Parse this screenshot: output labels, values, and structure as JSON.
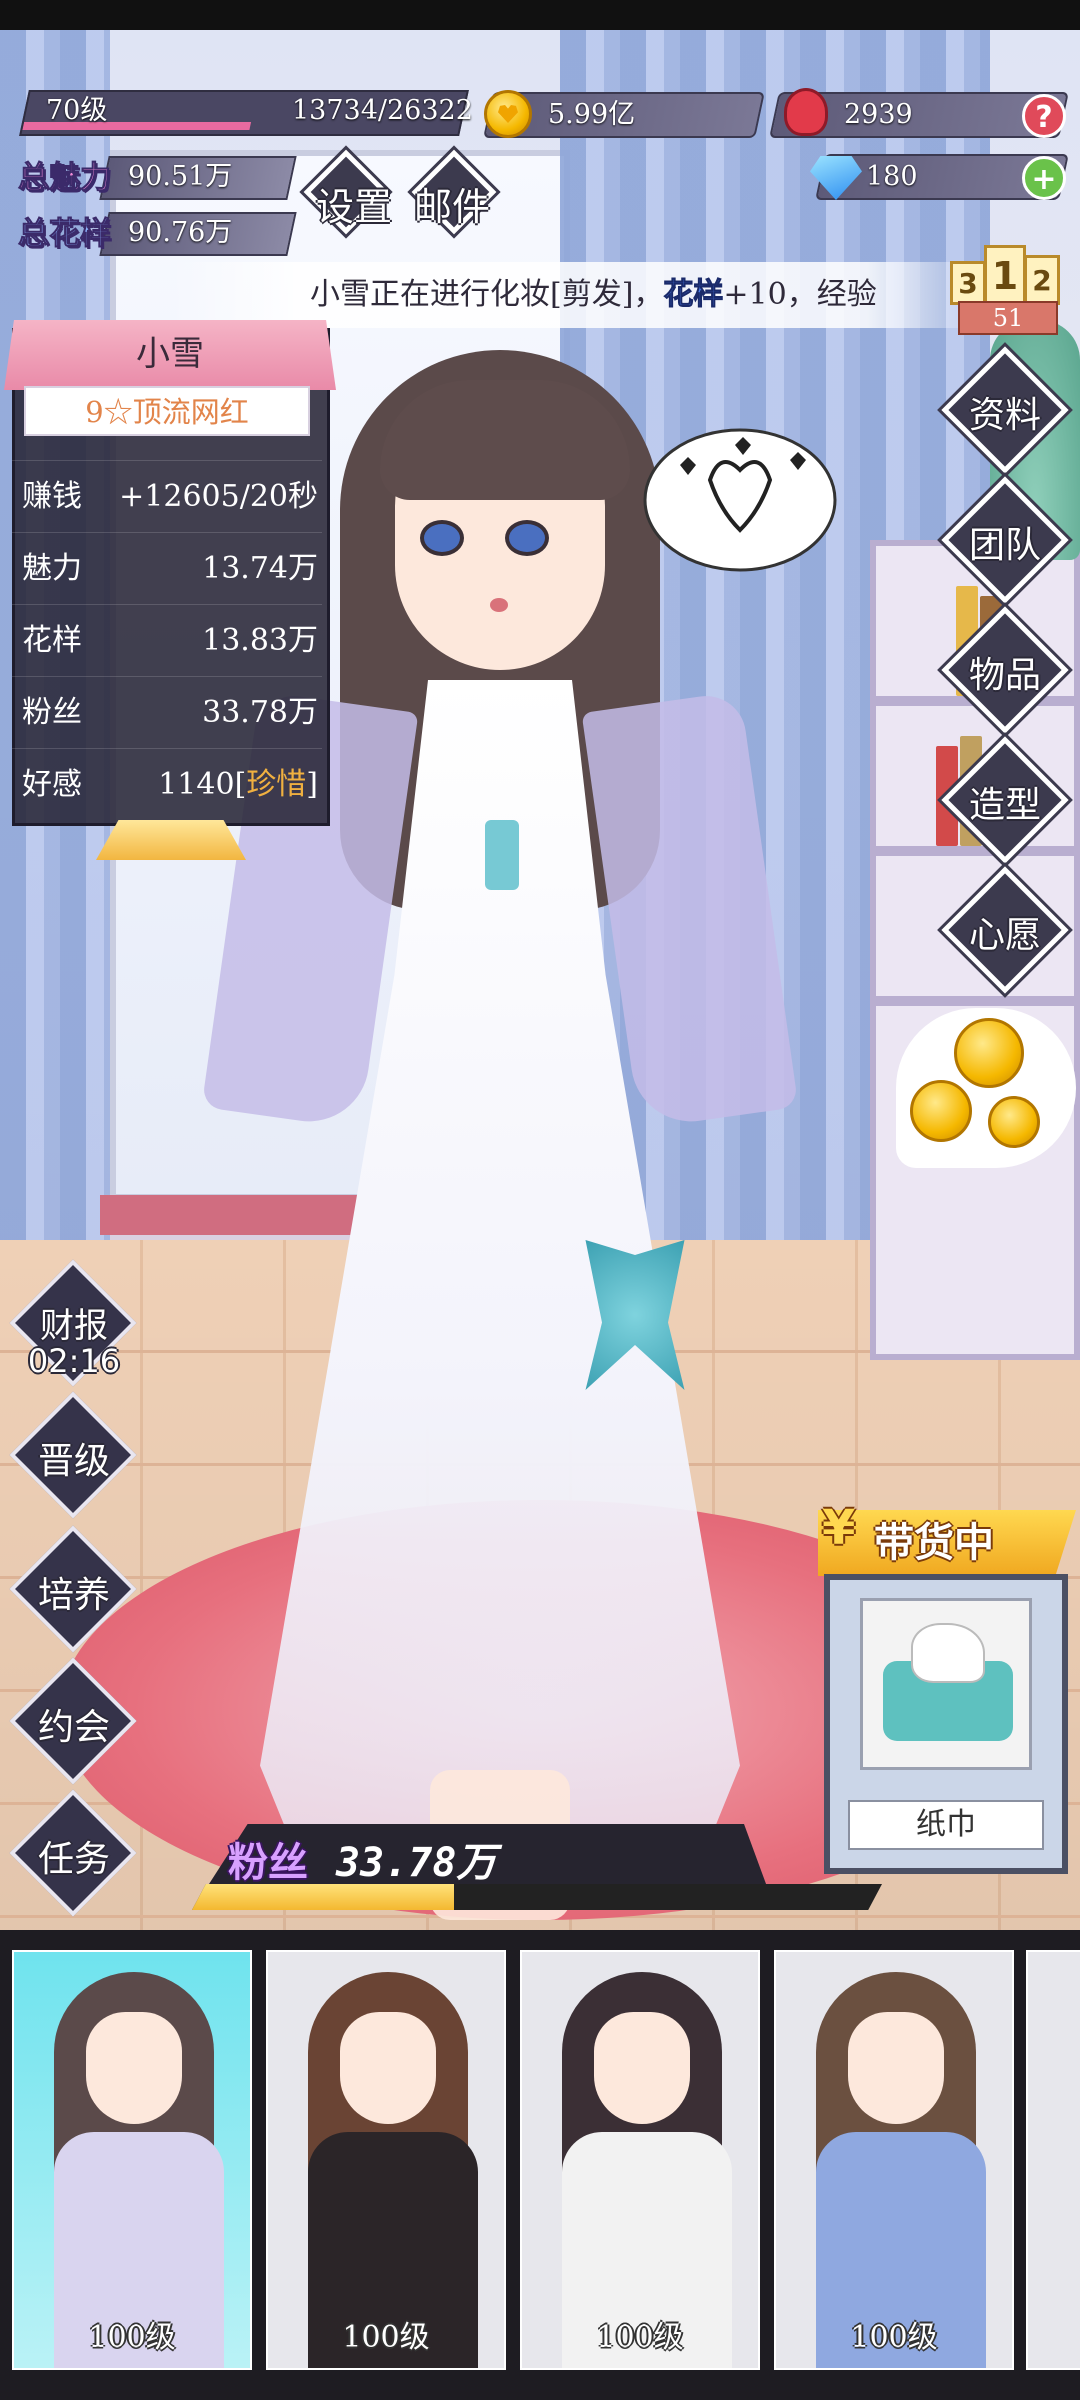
{
  "hud": {
    "level": "70级",
    "exp": "13734/26322",
    "exp_fraction": 0.52,
    "coins": "5.99亿",
    "roses": "2939",
    "diamonds": "180",
    "help_symbol": "?",
    "add_symbol": "+",
    "total_charm_label": "总魅力",
    "total_charm_value": "90.51万",
    "total_style_label": "总花样",
    "total_style_value": "90.76万",
    "settings_label": "设置",
    "mail_label": "邮件"
  },
  "ticker": {
    "prefix": "小雪正在进行化妆[剪发]，",
    "highlight": "花样",
    "suffix": "+10，经验"
  },
  "rank": {
    "first": "1",
    "second": "2",
    "third": "3",
    "value": "51"
  },
  "character_panel": {
    "name": "小雪",
    "title": "9☆顶流网红",
    "rows": [
      {
        "label": "赚钱",
        "value": "+12605/20秒"
      },
      {
        "label": "魅力",
        "value": "13.74万"
      },
      {
        "label": "花样",
        "value": "13.83万"
      },
      {
        "label": "粉丝",
        "value": "33.78万"
      }
    ],
    "affection_label": "好感",
    "affection_value": "1140",
    "affection_tag": "珍惜"
  },
  "right_menu": [
    "资料",
    "团队",
    "物品",
    "造型",
    "心愿"
  ],
  "left_menu": {
    "report_label": "财报",
    "report_timer": "02:16",
    "items": [
      "晋级",
      "培养",
      "约会",
      "任务"
    ]
  },
  "selling": {
    "yen": "¥",
    "banner": "带货中",
    "item_name": "纸巾"
  },
  "fans": {
    "label": "粉丝",
    "value": "33.78万",
    "progress_fraction": 0.38
  },
  "roster": [
    {
      "level": "100级",
      "hair": "#5b4a4a",
      "outfit": "#d9d4ef",
      "active": true
    },
    {
      "level": "100级",
      "hair": "#6a4434",
      "outfit": "#2b2528",
      "active": false
    },
    {
      "level": "100级",
      "hair": "#3b2f35",
      "outfit": "#f2f2f2",
      "active": false
    },
    {
      "level": "100级",
      "hair": "#6b5040",
      "outfit": "#8fa8e0",
      "active": false
    }
  ],
  "colors": {
    "accent_pink": "#e86aa0",
    "gold": "#f3b830",
    "panel_dark": "#282637",
    "tag_orange": "#f0b040"
  }
}
